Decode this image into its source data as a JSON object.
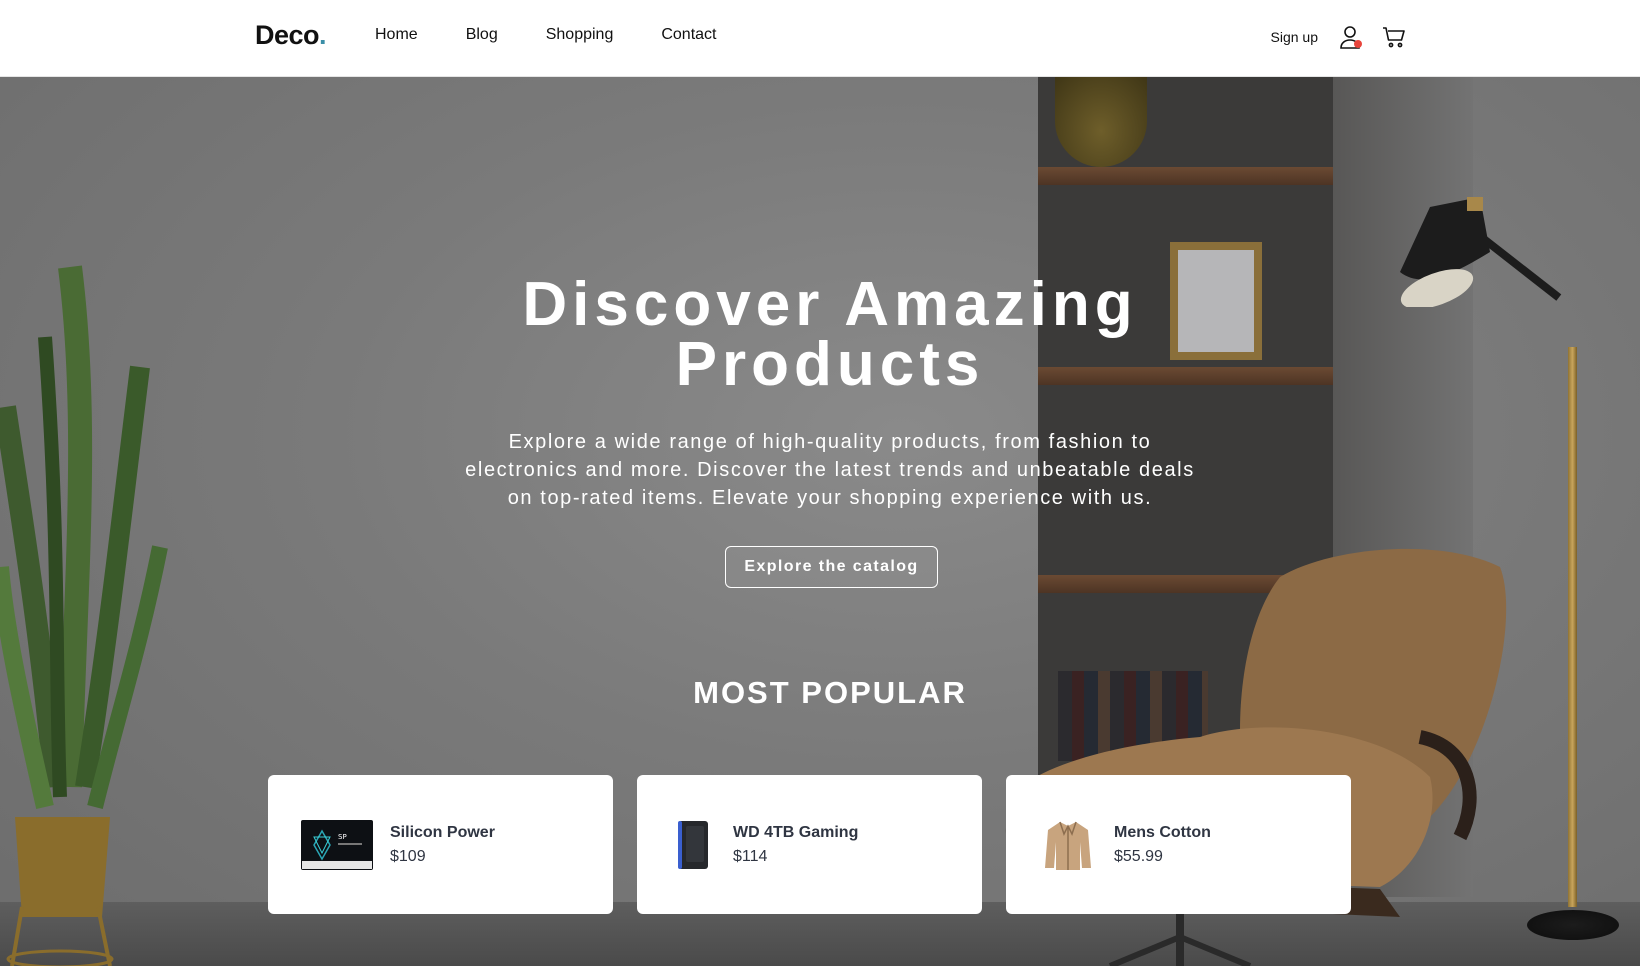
{
  "header": {
    "logo": "Deco",
    "logo_dot": ".",
    "nav": [
      "Home",
      "Blog",
      "Shopping",
      "Contact"
    ],
    "signup_label": "Sign up",
    "icons": {
      "account": "user-icon",
      "cart": "cart-icon"
    },
    "accent_color": "#3b8fa8",
    "notification_color": "#e8453c"
  },
  "hero": {
    "title_line1": "Discover Amazing",
    "title_line2": "Products",
    "description_line1": "Explore a wide range of high-quality products, from fashion to",
    "description_line2": "electronics and more. Discover the latest trends and unbeatable deals",
    "description_line3": "on top-rated items. Elevate your shopping experience with us.",
    "cta_label": "Explore the catalog"
  },
  "popular": {
    "title": "MOST POPULAR",
    "items": [
      {
        "name": "Silicon Power",
        "price": "$109",
        "image": "ssd-image"
      },
      {
        "name": "WD 4TB Gaming",
        "price": "$114",
        "image": "hard-drive-image"
      },
      {
        "name": "Mens Cotton",
        "price": "$55.99",
        "image": "jacket-image"
      }
    ]
  }
}
